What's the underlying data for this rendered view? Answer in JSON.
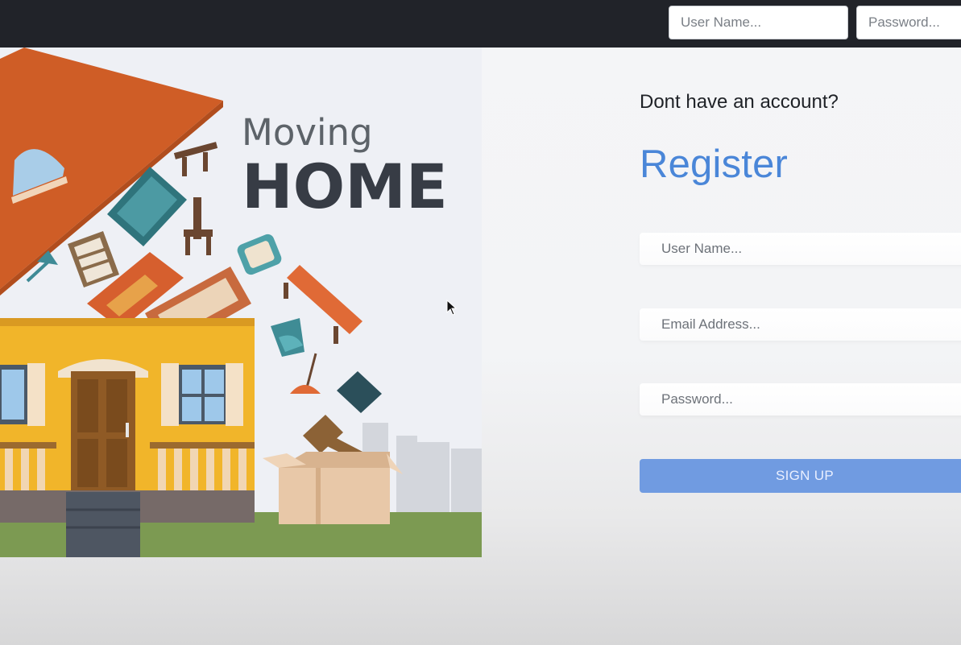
{
  "navbar": {
    "username_placeholder": "User Name...",
    "password_placeholder": "Password..."
  },
  "hero": {
    "title_line1": "Moving",
    "title_line2": "HOME"
  },
  "register": {
    "prompt": "Dont have an account?",
    "title": "Register",
    "username_placeholder": "User Name...",
    "email_placeholder": "Email Address...",
    "password_placeholder": "Password...",
    "submit_label": "SIGN UP"
  },
  "colors": {
    "navbar": "#212329",
    "accent": "#4a86d8",
    "button": "#709be1"
  }
}
